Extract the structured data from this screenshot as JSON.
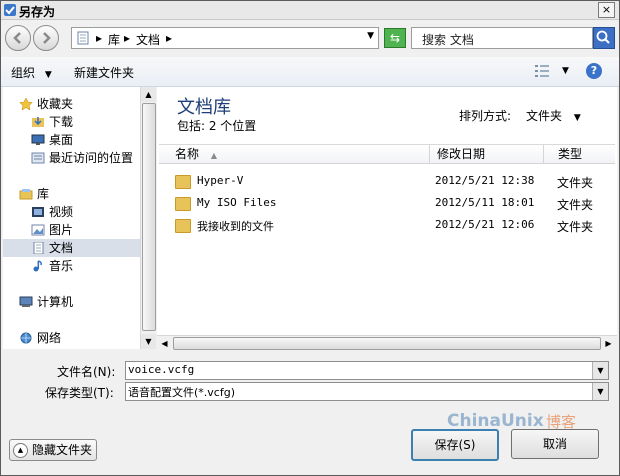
{
  "window": {
    "title": "另存为",
    "close": "×"
  },
  "address": {
    "crumbs": [
      "库",
      "文档"
    ]
  },
  "search": {
    "placeholder": "搜索 文档"
  },
  "toolbar": {
    "organize": "组织",
    "new_folder": "新建文件夹"
  },
  "sidebar": {
    "items": [
      {
        "label": "收藏夹",
        "icon": "star-icon"
      },
      {
        "label": "下载",
        "icon": "download-folder-icon"
      },
      {
        "label": "桌面",
        "icon": "desktop-icon"
      },
      {
        "label": "最近访问的位置",
        "icon": "recent-places-icon"
      },
      {
        "label": "库",
        "icon": "library-icon"
      },
      {
        "label": "视频",
        "icon": "video-icon"
      },
      {
        "label": "图片",
        "icon": "picture-icon"
      },
      {
        "label": "文档",
        "icon": "document-icon",
        "selected": true
      },
      {
        "label": "音乐",
        "icon": "music-icon"
      },
      {
        "label": "计算机",
        "icon": "computer-icon"
      },
      {
        "label": "网络",
        "icon": "network-icon"
      }
    ]
  },
  "library": {
    "title": "文档库",
    "subtitle": "包括: 2 个位置",
    "arrange_label": "排列方式:",
    "arrange_value": "文件夹"
  },
  "columns": {
    "name": "名称",
    "modified": "修改日期",
    "type": "类型"
  },
  "files": [
    {
      "name": "Hyper-V",
      "date": "2012/5/21 12:38",
      "type": "文件夹"
    },
    {
      "name": "My ISO Files",
      "date": "2012/5/11 18:01",
      "type": "文件夹"
    },
    {
      "name": "我接收到的文件",
      "date": "2012/5/21 12:06",
      "type": "文件夹"
    }
  ],
  "form": {
    "filename_label": "文件名(N):",
    "filename_value": "voice.vcfg",
    "filetype_label": "保存类型(T):",
    "filetype_value": "语音配置文件(*.vcfg)"
  },
  "buttons": {
    "save": "保存(S)",
    "cancel": "取消",
    "hide_folders": "隐藏文件夹"
  },
  "watermark": {
    "brand": "ChinaUnix",
    "suffix": "博客"
  }
}
